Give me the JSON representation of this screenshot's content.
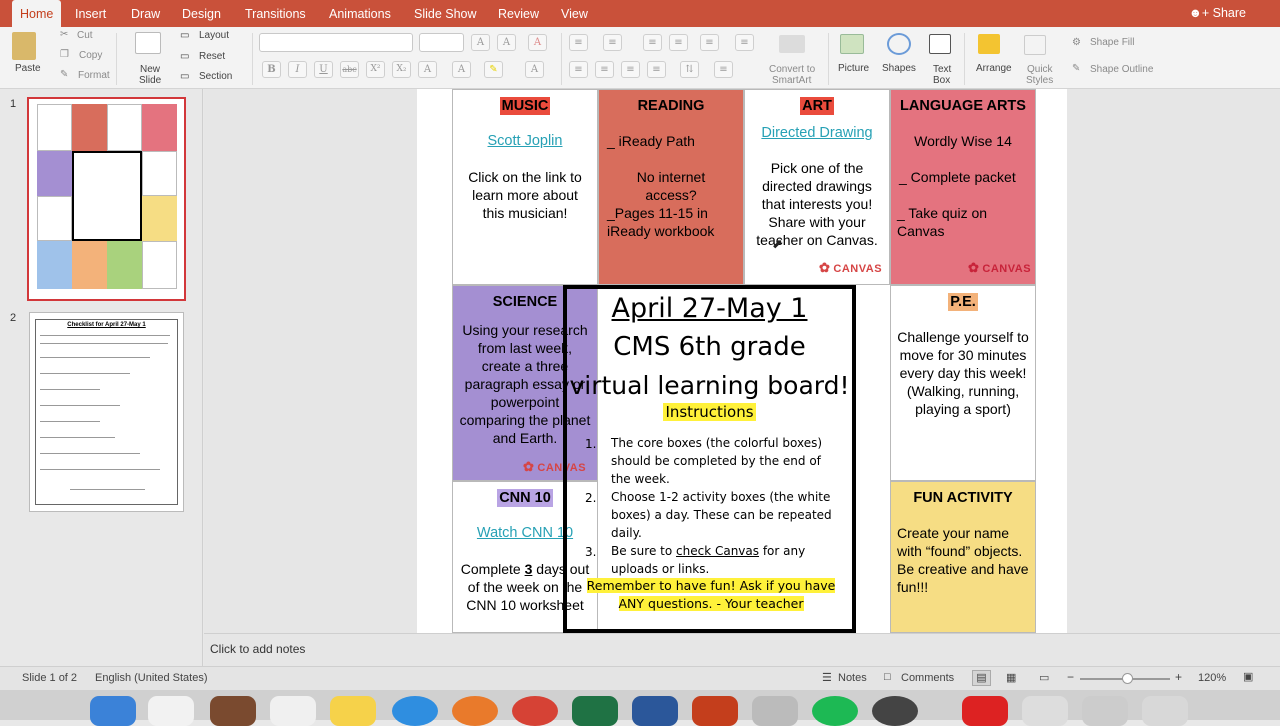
{
  "tabs": [
    "Home",
    "Insert",
    "Draw",
    "Design",
    "Transitions",
    "Animations",
    "Slide Show",
    "Review",
    "View"
  ],
  "share": "Share",
  "ribbon": {
    "paste": "Paste",
    "cut": "Cut",
    "copy": "Copy",
    "format": "Format",
    "new_slide_1": "New",
    "new_slide_2": "Slide",
    "layout": "Layout",
    "reset": "Reset",
    "section": "Section",
    "convert_1": "Convert to",
    "convert_2": "SmartArt",
    "picture": "Picture",
    "shapes": "Shapes",
    "textbox_1": "Text",
    "textbox_2": "Box",
    "arrange": "Arrange",
    "quick_styles_1": "Quick",
    "quick_styles_2": "Styles",
    "shape_fill": "Shape Fill",
    "shape_outline": "Shape Outline",
    "bold": "B",
    "italic": "I",
    "underline": "U",
    "strike": "abc",
    "superscript": "X²",
    "subscript": "X₂"
  },
  "thumbnails": [
    "1",
    "2"
  ],
  "thumb2_title": "Checklist for April 27-May 1",
  "slide": {
    "music": {
      "title": "MUSIC",
      "link": "Scott Joplin",
      "body": "Click on the link to learn more about this musician!"
    },
    "reading": {
      "title": "READING",
      "l1": "_ iReady Path",
      "l2": "No internet access?",
      "l3": "_Pages 11-15 in iReady workbook"
    },
    "art": {
      "title": "ART",
      "link": "Directed Drawing",
      "body": "Pick one of the directed drawings that interests you! Share with your teacher on Canvas.",
      "canvas": "CANVAS"
    },
    "language": {
      "title": "LANGUAGE ARTS",
      "l1": "Wordly Wise 14",
      "l2": "_ Complete packet",
      "l3": "_ Take quiz on Canvas",
      "canvas": "CANVAS"
    },
    "science": {
      "title": "SCIENCE",
      "body": "Using your research from last week, create a three paragraph essay or powerpoint comparing the planet and Earth.",
      "canvas": "CANVAS"
    },
    "center": {
      "t1": "April 27-May 1",
      "t2": "CMS 6th grade",
      "t3": "virtual learning board!",
      "instructions": "Instructions",
      "i1n": "1.",
      "i1": "The core boxes (the colorful boxes) should be completed by the end of the week.",
      "i2n": "2.",
      "i2": "Choose 1-2 activity boxes (the white boxes) a day. These can be repeated daily.",
      "i3n": "3.",
      "i3a": "Be sure to ",
      "i3b": "check Canvas",
      "i3c": " for any uploads or links.",
      "reminder": "Remember to have fun! Ask if you have ANY questions. - Your teacher"
    },
    "pe": {
      "title": "P.E.",
      "body": "Challenge yourself to move for 30 minutes every day this week! (Walking, running, playing a sport)"
    },
    "cnn": {
      "title": "CNN 10",
      "link": "Watch CNN 10",
      "b1": "Complete ",
      "b2": "3",
      "b3": " days out of the week on the CNN 10 worksheet"
    },
    "fun": {
      "title": "FUN ACTIVITY",
      "body": "Create your name with “found” objects. Be creative and have fun!!!"
    }
  },
  "notes_placeholder": "Click to add notes",
  "status": {
    "slide": "Slide 1 of 2",
    "language": "English (United States)",
    "notes": "Notes",
    "comments": "Comments",
    "zoom": "120%",
    "minus": "−",
    "plus": "+"
  },
  "colors": {
    "tabbar": "#c9513a",
    "music": "#ea4b3c",
    "reading": "#d86d5c",
    "language": "#e4737f",
    "science": "#a48fd2",
    "pe_title": "#f3b27a",
    "cnn_title": "#b9a4e4",
    "fun": "#f6dd84",
    "highlight": "#fff13a"
  }
}
